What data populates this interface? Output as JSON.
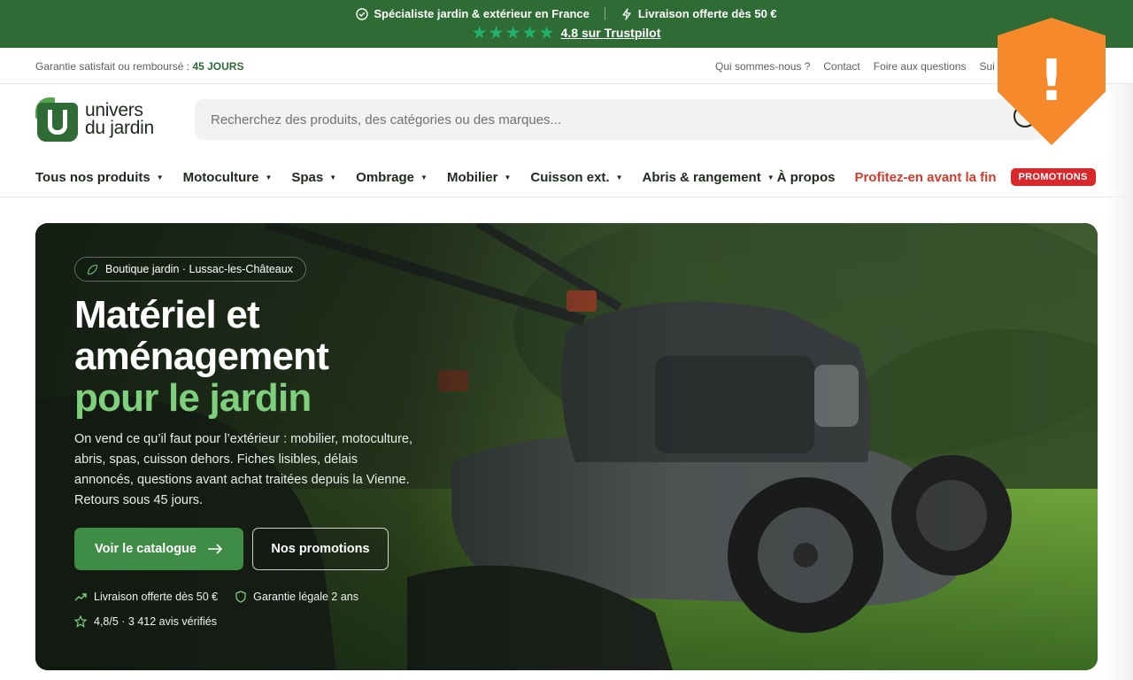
{
  "topbar": {
    "specialist": "Spécialiste jardin & extérieur en France",
    "delivery": "Livraison offerte dès 50 €",
    "rating": "4.8 sur Trustpilot",
    "star_color": "#23b26d",
    "background": "#2f6b34"
  },
  "utility": {
    "guarantee_prefix": "Garantie satisfait ou remboursé :",
    "guarantee_value": "45 JOURS",
    "links": [
      "Qui sommes-nous ?",
      "Contact",
      "Foire aux questions",
      "Sui"
    ]
  },
  "header": {
    "logo_line1": "univers",
    "logo_line2": "du jardin",
    "search_placeholder": "Recherchez des produits, des catégories ou des marques..."
  },
  "nav": {
    "items": [
      "Tous nos produits",
      "Motoculture",
      "Spas",
      "Ombrage",
      "Mobilier",
      "Cuisson ext.",
      "Abris & rangement"
    ],
    "about": "À propos",
    "promo_text": "Profitez-en avant la fin",
    "promo_badge": "PROMOTIONS",
    "accent_color": "#d8282b"
  },
  "warning": {
    "icon": "warning-shield-icon",
    "mark": "!",
    "color": "#f6892b"
  },
  "hero": {
    "tag": "Boutique jardin · Lussac-les-Châteaux",
    "title_line1": "Matériel et",
    "title_line2": "aménagement",
    "title_accent": "pour le jardin",
    "description": "On vend ce qu’il faut pour l’extérieur : mobilier, motoculture, abris, spas, cuisson dehors. Fiches lisibles, délais annoncés, questions avant achat traitées depuis la Vienne. Retours sous 45 jours.",
    "primary_button": "Voir le catalogue",
    "secondary_button": "Nos promotions",
    "badge_delivery": "Livraison offerte dès 50 €",
    "badge_warranty": "Garantie légale 2 ans",
    "badge_reviews": "4,8/5 · 3 412 avis vérifiés",
    "accent_color": "#7fd07c",
    "image": "lawn-mower-on-grass"
  }
}
